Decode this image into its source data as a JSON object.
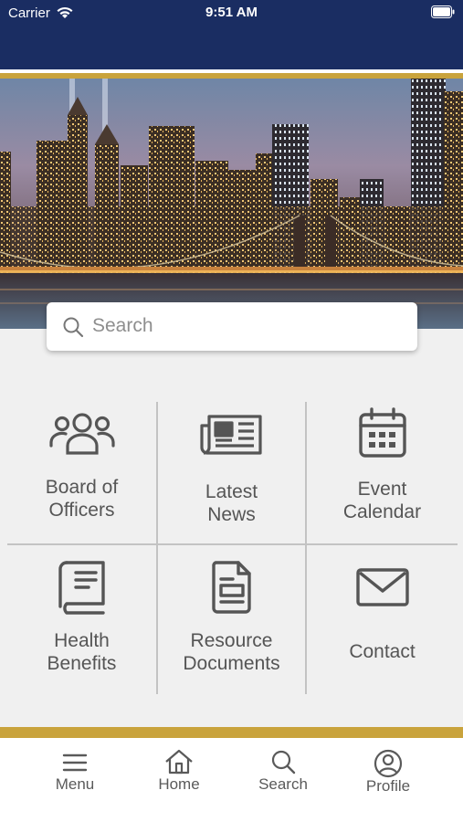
{
  "status_bar": {
    "carrier": "Carrier",
    "time": "9:51 AM"
  },
  "search": {
    "placeholder": "Search"
  },
  "tiles": [
    {
      "label": "Board of\nOfficers",
      "icon": "people-icon"
    },
    {
      "label": "Latest\nNews",
      "icon": "newspaper-icon"
    },
    {
      "label": "Event\nCalendar",
      "icon": "calendar-icon"
    },
    {
      "label": "Health\nBenefits",
      "icon": "book-icon"
    },
    {
      "label": "Resource\nDocuments",
      "icon": "document-icon"
    },
    {
      "label": "Contact",
      "icon": "envelope-icon"
    }
  ],
  "tab_bar": {
    "items": [
      {
        "label": "Menu",
        "icon": "hamburger-icon"
      },
      {
        "label": "Home",
        "icon": "home-icon"
      },
      {
        "label": "Search",
        "icon": "search-icon"
      },
      {
        "label": "Profile",
        "icon": "profile-icon"
      }
    ]
  },
  "colors": {
    "nav_blue": "#1a2d62",
    "gold": "#c9a33c",
    "tile_bg": "#f0f0f0",
    "icon_gray": "#555555"
  }
}
